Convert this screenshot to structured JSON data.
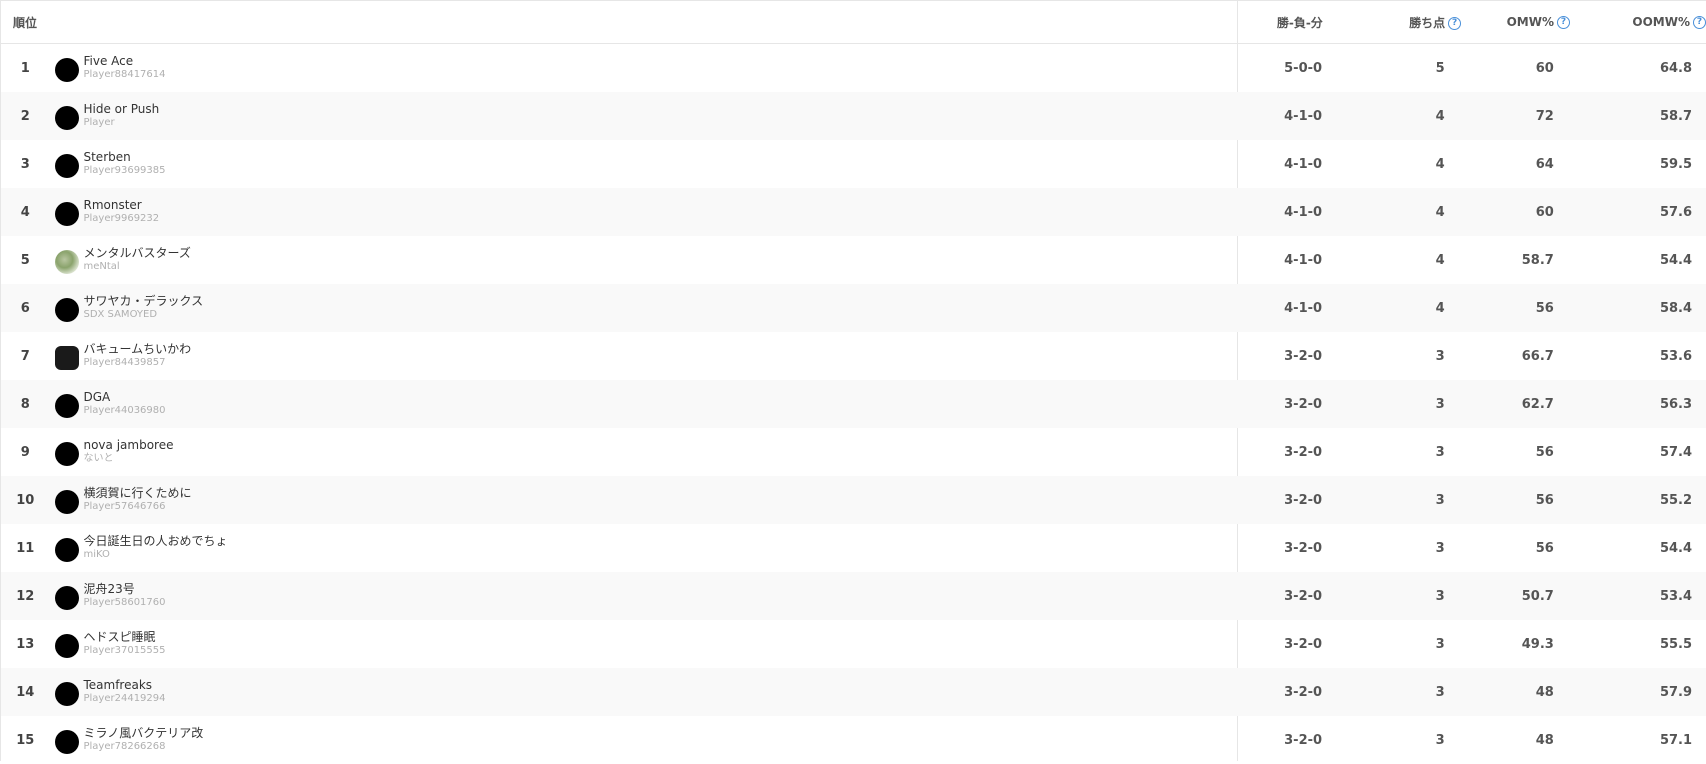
{
  "header": {
    "rank": "順位",
    "wld": "勝-負-分",
    "points": "勝ち点",
    "omw": "OMW%",
    "oomw": "OOMW%",
    "help_icon_glyph": "?"
  },
  "rows": [
    {
      "rank": "1",
      "name": "Five Ace",
      "id": "Player88417614",
      "wld": "5-0-0",
      "points": "5",
      "omw": "60",
      "oomw": "64.8"
    },
    {
      "rank": "2",
      "name": "Hide or Push",
      "id": "Player",
      "wld": "4-1-0",
      "points": "4",
      "omw": "72",
      "oomw": "58.7"
    },
    {
      "rank": "3",
      "name": "Sterben",
      "id": "Player93699385",
      "wld": "4-1-0",
      "points": "4",
      "omw": "64",
      "oomw": "59.5"
    },
    {
      "rank": "4",
      "name": "Rmonster",
      "id": "Player9969232",
      "wld": "4-1-0",
      "points": "4",
      "omw": "60",
      "oomw": "57.6"
    },
    {
      "rank": "5",
      "name": "メンタルバスターズ",
      "id": "meNtal",
      "wld": "4-1-0",
      "points": "4",
      "omw": "58.7",
      "oomw": "54.4"
    },
    {
      "rank": "6",
      "name": "サワヤカ・デラックス",
      "id": "SDX SAMOYED",
      "wld": "4-1-0",
      "points": "4",
      "omw": "56",
      "oomw": "58.4"
    },
    {
      "rank": "7",
      "name": "バキュームちいかわ",
      "id": "Player84439857",
      "wld": "3-2-0",
      "points": "3",
      "omw": "66.7",
      "oomw": "53.6"
    },
    {
      "rank": "8",
      "name": "DGA",
      "id": "Player44036980",
      "wld": "3-2-0",
      "points": "3",
      "omw": "62.7",
      "oomw": "56.3"
    },
    {
      "rank": "9",
      "name": "nova jamboree",
      "id": "ないと",
      "wld": "3-2-0",
      "points": "3",
      "omw": "56",
      "oomw": "57.4"
    },
    {
      "rank": "10",
      "name": "横須賀に行くために",
      "id": "Player57646766",
      "wld": "3-2-0",
      "points": "3",
      "omw": "56",
      "oomw": "55.2"
    },
    {
      "rank": "11",
      "name": "今日誕生日の人おめでちょ",
      "id": "miKO",
      "wld": "3-2-0",
      "points": "3",
      "omw": "56",
      "oomw": "54.4"
    },
    {
      "rank": "12",
      "name": "泥舟23号",
      "id": "Player58601760",
      "wld": "3-2-0",
      "points": "3",
      "omw": "50.7",
      "oomw": "53.4"
    },
    {
      "rank": "13",
      "name": "ヘドスピ睡眠",
      "id": "Player37015555",
      "wld": "3-2-0",
      "points": "3",
      "omw": "49.3",
      "oomw": "55.5"
    },
    {
      "rank": "14",
      "name": "Teamfreaks",
      "id": "Player24419294",
      "wld": "3-2-0",
      "points": "3",
      "omw": "48",
      "oomw": "57.9"
    },
    {
      "rank": "15",
      "name": "ミラノ風バクテリア改",
      "id": "Player78266268",
      "wld": "3-2-0",
      "points": "3",
      "omw": "48",
      "oomw": "57.1"
    }
  ]
}
